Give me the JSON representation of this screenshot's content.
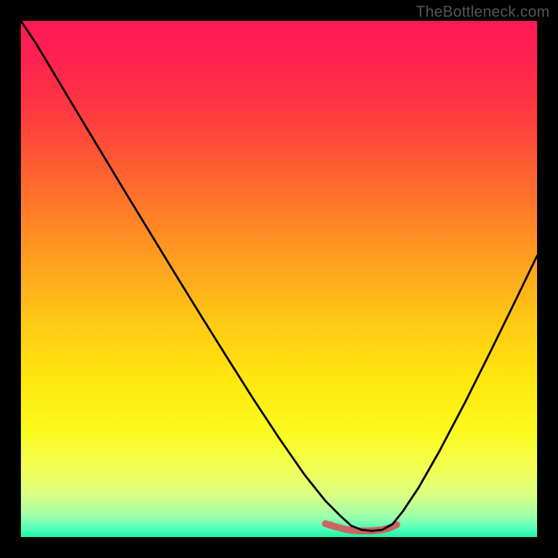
{
  "watermark": "TheBottleneck.com",
  "colors": {
    "frame": "#000000",
    "gradient_stops": [
      {
        "offset": 0.0,
        "color": "#ff1a55"
      },
      {
        "offset": 0.07,
        "color": "#ff2050"
      },
      {
        "offset": 0.18,
        "color": "#ff3a40"
      },
      {
        "offset": 0.3,
        "color": "#ff6330"
      },
      {
        "offset": 0.45,
        "color": "#ff9a20"
      },
      {
        "offset": 0.58,
        "color": "#ffc814"
      },
      {
        "offset": 0.7,
        "color": "#ffe80e"
      },
      {
        "offset": 0.8,
        "color": "#fbfb20"
      },
      {
        "offset": 0.87,
        "color": "#f2ff58"
      },
      {
        "offset": 0.92,
        "color": "#d8ff84"
      },
      {
        "offset": 0.96,
        "color": "#9cffac"
      },
      {
        "offset": 0.985,
        "color": "#4dffb8"
      },
      {
        "offset": 1.0,
        "color": "#1ef2a8"
      }
    ],
    "curve": "#000000",
    "trough_marker": "#c96562"
  },
  "chart_data": {
    "type": "line",
    "title": "",
    "xlabel": "",
    "ylabel": "",
    "xlim": [
      0,
      1
    ],
    "ylim": [
      0,
      1
    ],
    "note": "x is normalized horizontal position across the plot area; y is normalized bottleneck magnitude (1 = top of plot, 0 = bottom). Curve is a V-shape with minimum near x≈0.64–0.70 where y≈0.01.",
    "series": [
      {
        "name": "bottleneck-curve",
        "x": [
          0.0,
          0.03,
          0.06,
          0.1,
          0.15,
          0.2,
          0.25,
          0.3,
          0.35,
          0.4,
          0.45,
          0.5,
          0.55,
          0.59,
          0.62,
          0.64,
          0.66,
          0.68,
          0.7,
          0.72,
          0.74,
          0.77,
          0.81,
          0.86,
          0.91,
          0.96,
          1.0
        ],
        "y": [
          1.0,
          0.955,
          0.905,
          0.838,
          0.755,
          0.672,
          0.59,
          0.508,
          0.427,
          0.347,
          0.268,
          0.192,
          0.12,
          0.07,
          0.04,
          0.022,
          0.014,
          0.012,
          0.014,
          0.025,
          0.05,
          0.095,
          0.165,
          0.26,
          0.36,
          0.462,
          0.545
        ]
      }
    ],
    "trough_marker": {
      "note": "short salmon segment along the flat bottom of the V",
      "x": [
        0.59,
        0.61,
        0.625,
        0.64,
        0.66,
        0.68,
        0.7,
        0.715,
        0.728
      ],
      "y": [
        0.026,
        0.02,
        0.016,
        0.013,
        0.012,
        0.012,
        0.014,
        0.018,
        0.024
      ]
    }
  }
}
